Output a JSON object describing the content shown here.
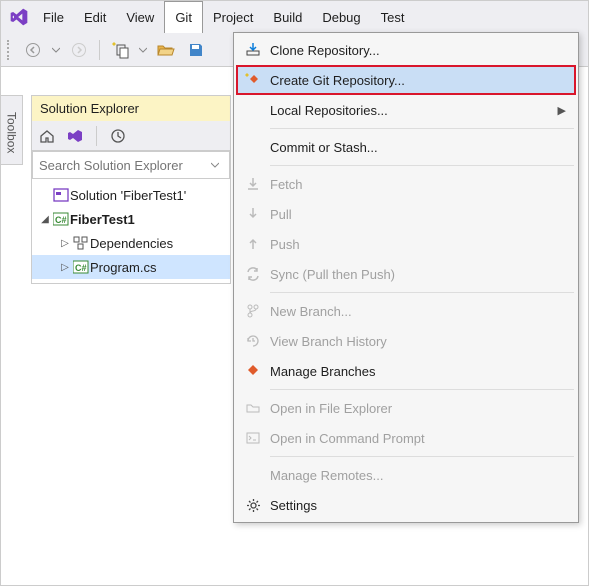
{
  "menubar": {
    "items": [
      "File",
      "Edit",
      "View",
      "Git",
      "Project",
      "Build",
      "Debug",
      "Test"
    ],
    "open_index": 3
  },
  "toolbox": {
    "label": "Toolbox"
  },
  "solution_explorer": {
    "title": "Solution Explorer",
    "search_placeholder": "Search Solution Explorer",
    "tree": {
      "solution": "Solution 'FiberTest1'",
      "project": "FiberTest1",
      "dependencies": "Dependencies",
      "program": "Program.cs"
    }
  },
  "git_menu": {
    "clone": "Clone Repository...",
    "create": "Create Git Repository...",
    "local_repos": "Local Repositories...",
    "commit": "Commit or Stash...",
    "fetch": "Fetch",
    "pull": "Pull",
    "push": "Push",
    "sync": "Sync (Pull then Push)",
    "new_branch": "New Branch...",
    "view_history": "View Branch History",
    "manage_branches": "Manage Branches",
    "open_explorer": "Open in File Explorer",
    "open_cmd": "Open in Command Prompt",
    "manage_remotes": "Manage Remotes...",
    "settings": "Settings"
  }
}
